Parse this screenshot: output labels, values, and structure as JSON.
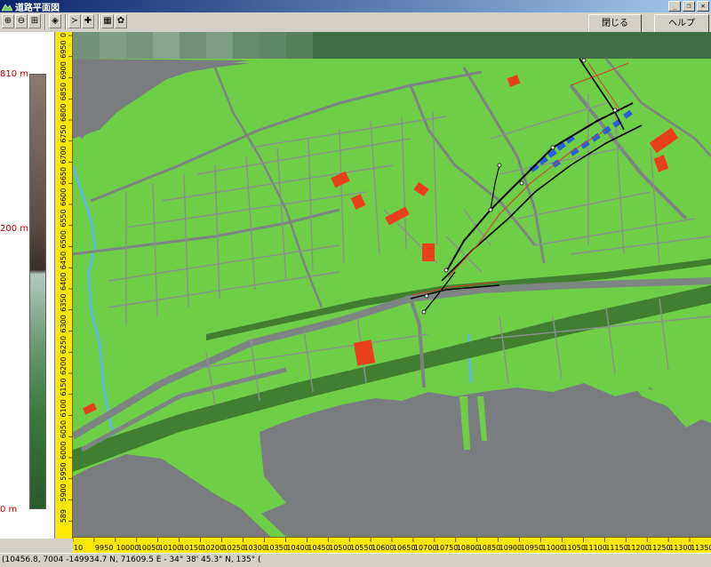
{
  "window": {
    "title": "道路平面図",
    "minimize": "_",
    "restore": "❐",
    "close": "✕"
  },
  "toolbar": {
    "zoom_in": "⊕",
    "zoom_out": "⊖",
    "fit": "⊞",
    "tool_a": "◈",
    "tool_b": "≻",
    "tool_c": "✚",
    "tool_d": "▦",
    "tool_e": "✿",
    "close_label": "閉じる",
    "help_label": "ヘルプ"
  },
  "legend": {
    "top_label": "810 m",
    "mid_label": "200 m",
    "bottom_label": "0 m"
  },
  "ruler_v": [
    "0",
    "6950",
    "6900",
    "6850",
    "6800",
    "6750",
    "6700",
    "6650",
    "6600",
    "6550",
    "6500",
    "6450",
    "6400",
    "6350",
    "6300",
    "6250",
    "6200",
    "6150",
    "6100",
    "6050",
    "6000",
    "5950",
    "5900",
    "589"
  ],
  "ruler_h": [
    "10",
    "9950",
    "10000",
    "10050",
    "10100",
    "10150",
    "10200",
    "10250",
    "10300",
    "10350",
    "10400",
    "10450",
    "10500",
    "10550",
    "10600",
    "10650",
    "10700",
    "10750",
    "10800",
    "10850",
    "10900",
    "10950",
    "11000",
    "11050",
    "11100",
    "11150",
    "11200",
    "11250",
    "11300",
    "11350"
  ],
  "status": "(10456.8, 7004  -149934.7 N, 71609.5 E  -  34° 38' 45.3\" N, 135° (",
  "colors": {
    "land": "#6fce48",
    "sea": "#7a7d80",
    "road": "#7d8582",
    "rail": "#3f7f2f",
    "building": "#e8401c",
    "station": "#2a5fd8"
  }
}
